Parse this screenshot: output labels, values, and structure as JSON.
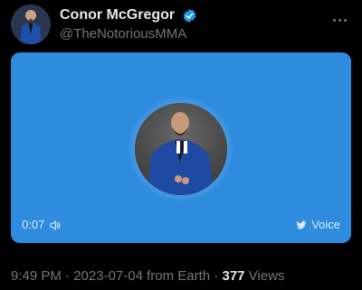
{
  "author": {
    "display_name": "Conor McGregor",
    "handle": "@TheNotoriousMMA"
  },
  "icons": {
    "verified": "verified-badge-icon",
    "more": "more-options-icon",
    "pause": "pause-icon",
    "speaker": "speaker-icon",
    "bird": "twitter-bird-icon"
  },
  "audio": {
    "elapsed": "0:07",
    "badge_label": "Voice",
    "progress": 0,
    "accent_color": "#2e8bde"
  },
  "meta": {
    "time": "9:49 PM",
    "separator1": " · ",
    "date": "2023-07-04",
    "location": " from Earth",
    "separator2": " · ",
    "views_count": "377",
    "views_label": " Views"
  }
}
